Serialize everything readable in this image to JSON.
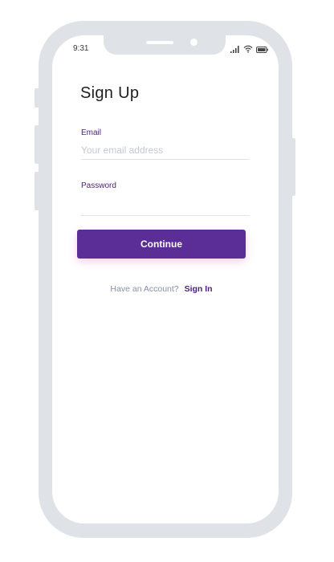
{
  "status_bar": {
    "time": "9:31",
    "icons": [
      "signal-icon",
      "wifi-icon",
      "battery-icon"
    ]
  },
  "form": {
    "title": "Sign Up",
    "email_label": "Email",
    "email_placeholder": "Your email address",
    "email_value": "",
    "password_label": "Password",
    "password_placeholder": "",
    "password_value": "",
    "continue_label": "Continue"
  },
  "footer": {
    "account_prompt": "Have an Account?",
    "signin_label": "Sign In"
  },
  "colors": {
    "accent": "#5a2e96",
    "label": "#4b1f7d",
    "frame": "#dfe2e6",
    "muted_text": "#8a8fa6"
  }
}
